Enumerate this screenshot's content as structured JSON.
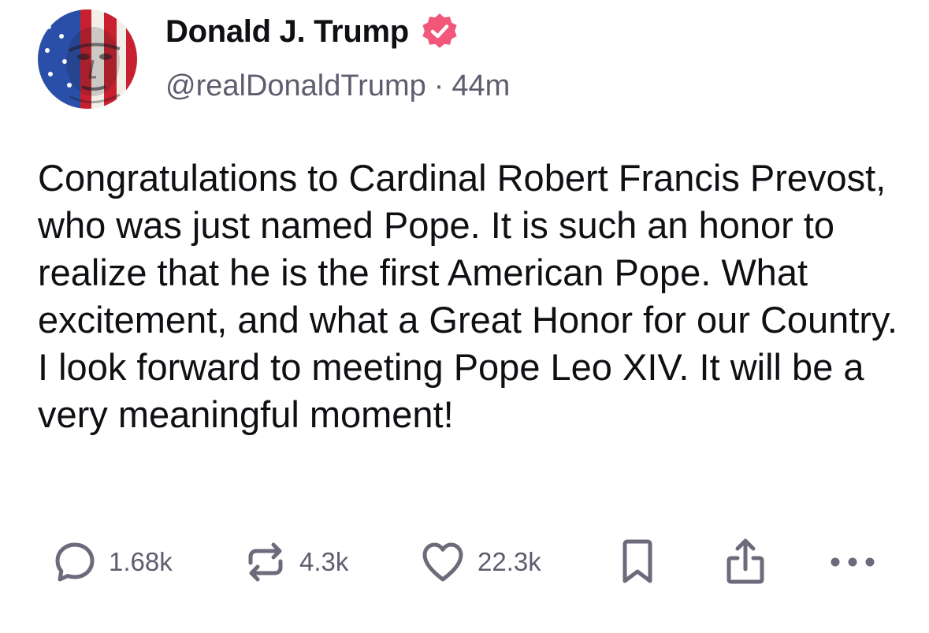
{
  "author": {
    "display_name": "Donald J. Trump",
    "handle": "@realDonaldTrump",
    "separator": "·",
    "time_ago": "44m",
    "verified_badge_icon": "verified-badge-icon",
    "verified_color": "#f2577a"
  },
  "post": {
    "text": "Congratulations to Cardinal Robert Francis Prevost, who was just named Pope. It is such an honor to realize that he is the first American Pope. What excitement, and what a Great Honor for our Country. I look forward to meeting Pope Leo XIV. It will be a very meaningful moment!"
  },
  "actions": {
    "reply": {
      "icon": "reply-icon",
      "count": "1.68k"
    },
    "repost": {
      "icon": "repost-icon",
      "count": "4.3k"
    },
    "like": {
      "icon": "heart-icon",
      "count": "22.3k"
    },
    "bookmark": {
      "icon": "bookmark-icon"
    },
    "share": {
      "icon": "share-icon"
    },
    "more": {
      "icon": "more-icon"
    }
  },
  "colors": {
    "text": "#0f0f14",
    "secondary_text": "#5d5d6e",
    "icon": "#6b6b7b",
    "background": "#ffffff"
  }
}
